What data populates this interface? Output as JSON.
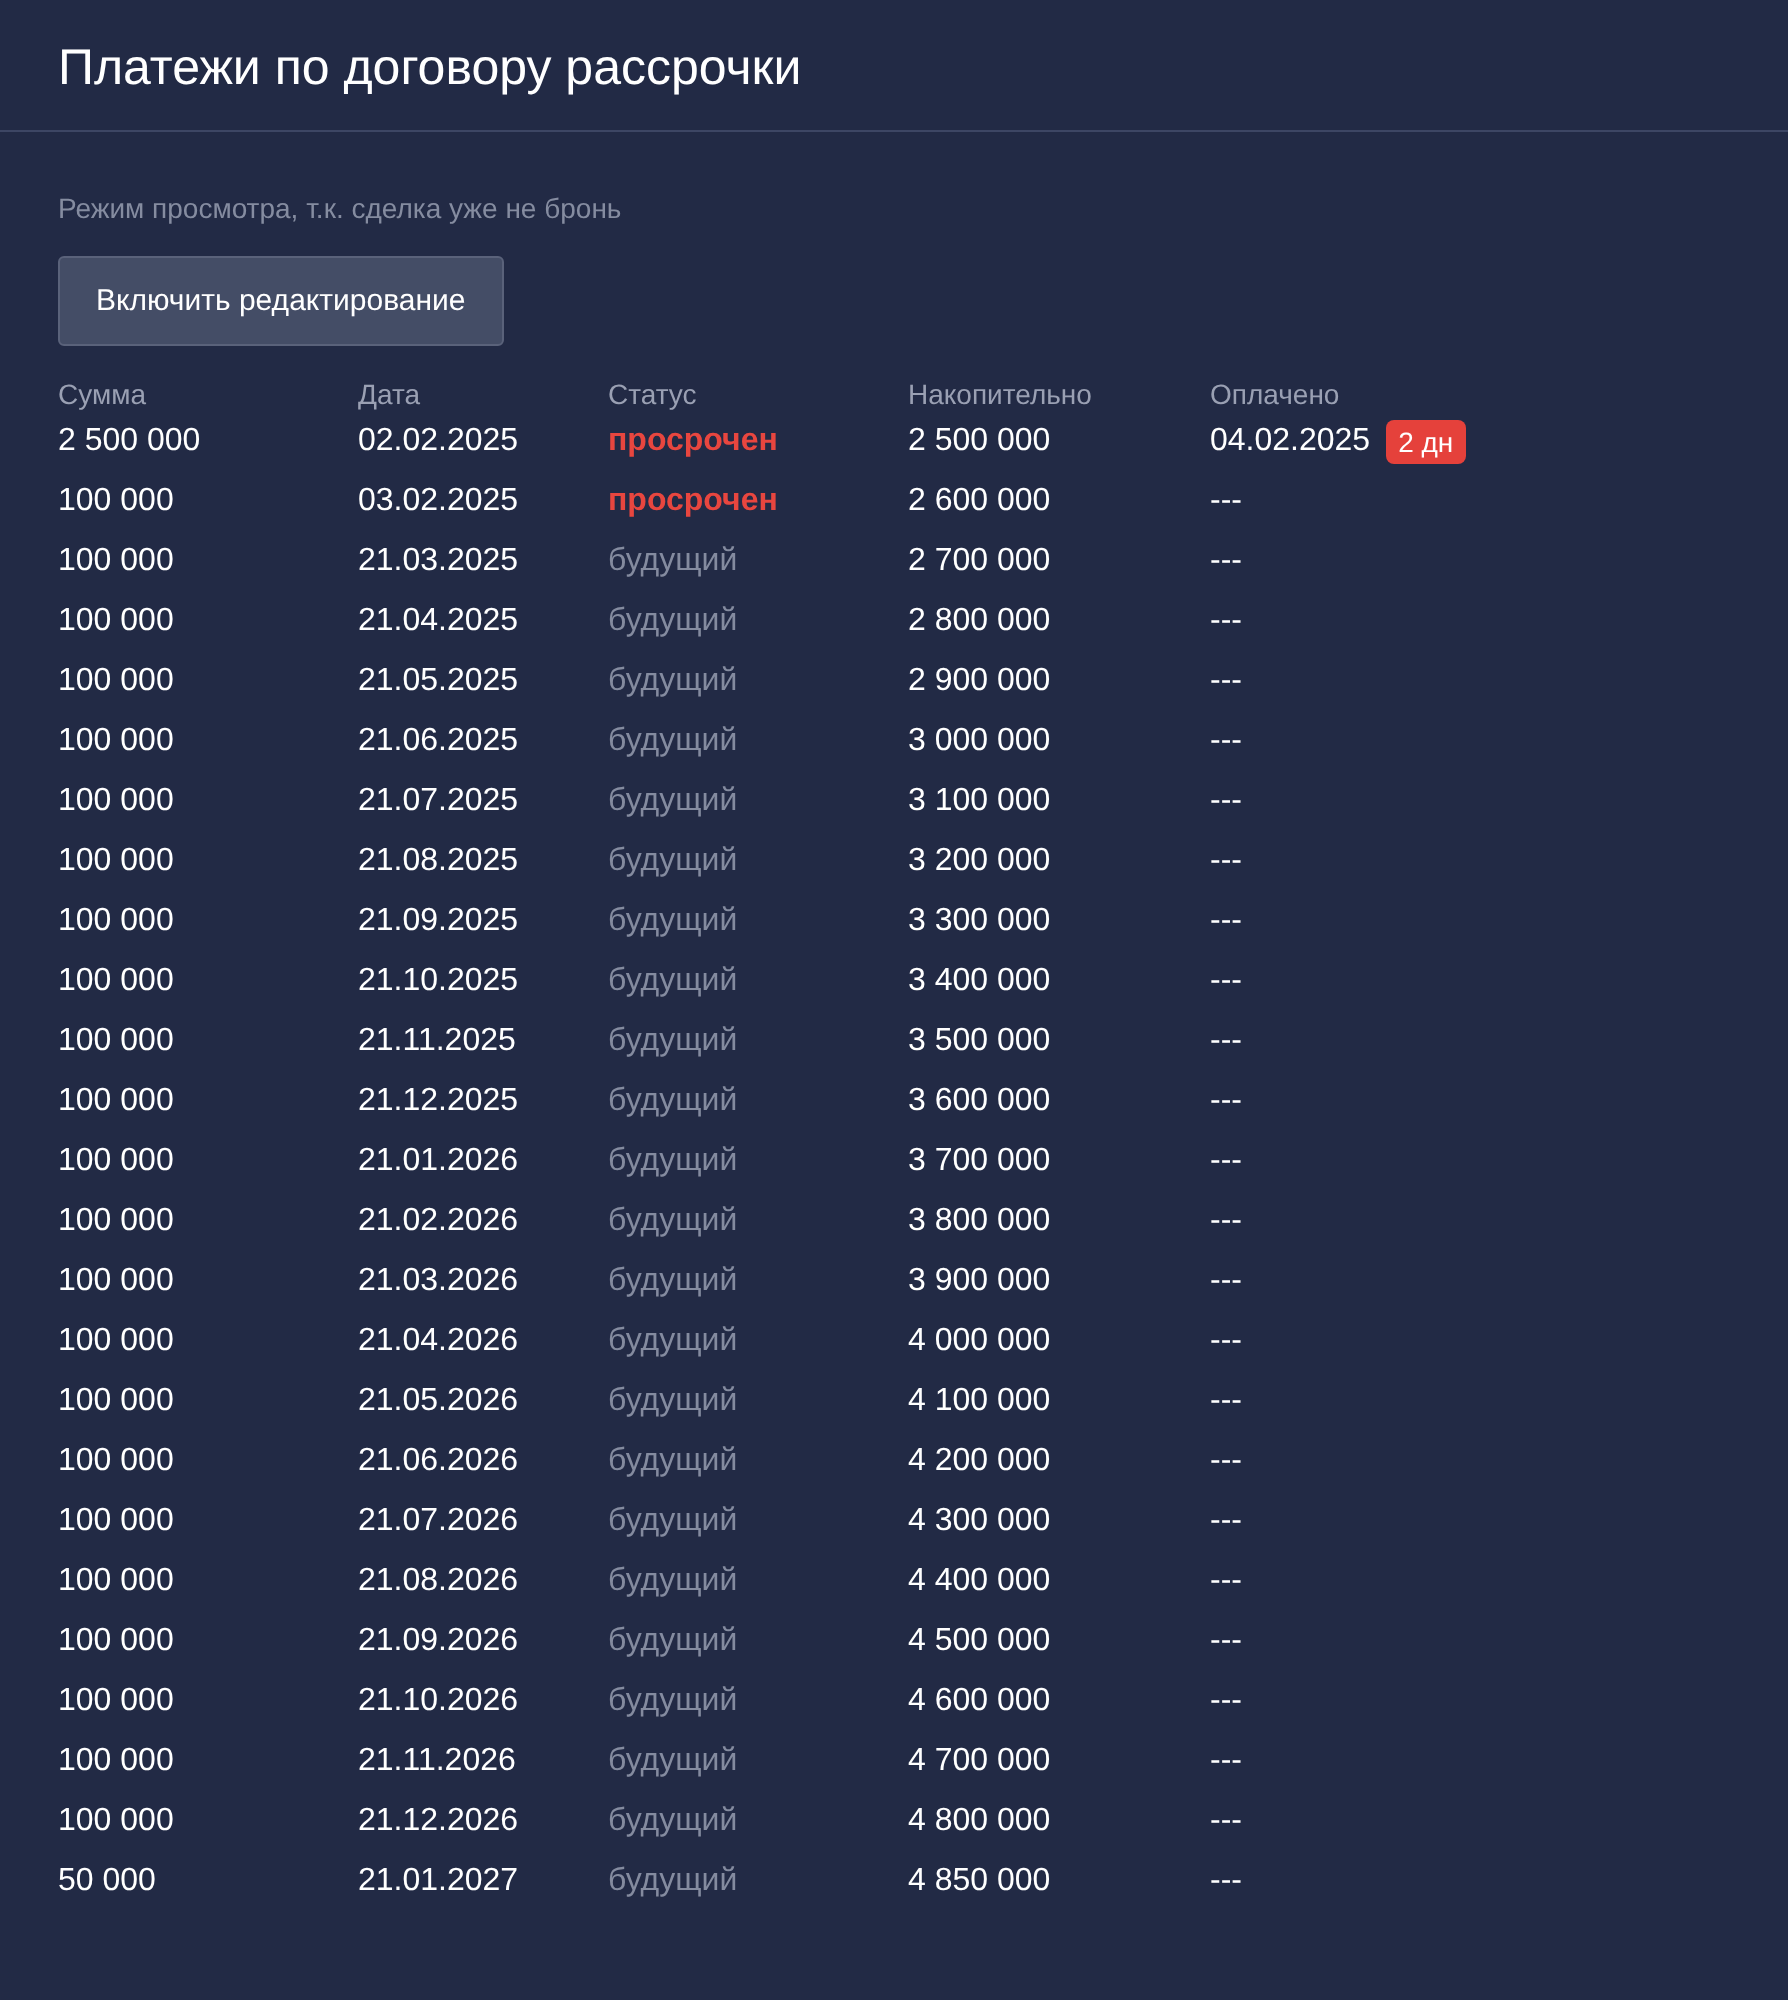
{
  "title": "Платежи по договору рассрочки",
  "notice": "Режим просмотра, т.к. сделка уже не бронь",
  "edit_button": "Включить редактирование",
  "table": {
    "columns": [
      "Сумма",
      "Дата",
      "Статус",
      "Накопительно",
      "Оплачено"
    ],
    "rows": [
      {
        "amount": "2 500 000",
        "date": "02.02.2025",
        "status": "просрочен",
        "overdue": true,
        "cumulative": "2 500 000",
        "paid": "04.02.2025",
        "delay": "2 дн"
      },
      {
        "amount": "100 000",
        "date": "03.02.2025",
        "status": "просрочен",
        "overdue": true,
        "cumulative": "2 600 000",
        "paid": "---"
      },
      {
        "amount": "100 000",
        "date": "21.03.2025",
        "status": "будущий",
        "overdue": false,
        "cumulative": "2 700 000",
        "paid": "---"
      },
      {
        "amount": "100 000",
        "date": "21.04.2025",
        "status": "будущий",
        "overdue": false,
        "cumulative": "2 800 000",
        "paid": "---"
      },
      {
        "amount": "100 000",
        "date": "21.05.2025",
        "status": "будущий",
        "overdue": false,
        "cumulative": "2 900 000",
        "paid": "---"
      },
      {
        "amount": "100 000",
        "date": "21.06.2025",
        "status": "будущий",
        "overdue": false,
        "cumulative": "3 000 000",
        "paid": "---"
      },
      {
        "amount": "100 000",
        "date": "21.07.2025",
        "status": "будущий",
        "overdue": false,
        "cumulative": "3 100 000",
        "paid": "---"
      },
      {
        "amount": "100 000",
        "date": "21.08.2025",
        "status": "будущий",
        "overdue": false,
        "cumulative": "3 200 000",
        "paid": "---"
      },
      {
        "amount": "100 000",
        "date": "21.09.2025",
        "status": "будущий",
        "overdue": false,
        "cumulative": "3 300 000",
        "paid": "---"
      },
      {
        "amount": "100 000",
        "date": "21.10.2025",
        "status": "будущий",
        "overdue": false,
        "cumulative": "3 400 000",
        "paid": "---"
      },
      {
        "amount": "100 000",
        "date": "21.11.2025",
        "status": "будущий",
        "overdue": false,
        "cumulative": "3 500 000",
        "paid": "---"
      },
      {
        "amount": "100 000",
        "date": "21.12.2025",
        "status": "будущий",
        "overdue": false,
        "cumulative": "3 600 000",
        "paid": "---"
      },
      {
        "amount": "100 000",
        "date": "21.01.2026",
        "status": "будущий",
        "overdue": false,
        "cumulative": "3 700 000",
        "paid": "---"
      },
      {
        "amount": "100 000",
        "date": "21.02.2026",
        "status": "будущий",
        "overdue": false,
        "cumulative": "3 800 000",
        "paid": "---"
      },
      {
        "amount": "100 000",
        "date": "21.03.2026",
        "status": "будущий",
        "overdue": false,
        "cumulative": "3 900 000",
        "paid": "---"
      },
      {
        "amount": "100 000",
        "date": "21.04.2026",
        "status": "будущий",
        "overdue": false,
        "cumulative": "4 000 000",
        "paid": "---"
      },
      {
        "amount": "100 000",
        "date": "21.05.2026",
        "status": "будущий",
        "overdue": false,
        "cumulative": "4 100 000",
        "paid": "---"
      },
      {
        "amount": "100 000",
        "date": "21.06.2026",
        "status": "будущий",
        "overdue": false,
        "cumulative": "4 200 000",
        "paid": "---"
      },
      {
        "amount": "100 000",
        "date": "21.07.2026",
        "status": "будущий",
        "overdue": false,
        "cumulative": "4 300 000",
        "paid": "---"
      },
      {
        "amount": "100 000",
        "date": "21.08.2026",
        "status": "будущий",
        "overdue": false,
        "cumulative": "4 400 000",
        "paid": "---"
      },
      {
        "amount": "100 000",
        "date": "21.09.2026",
        "status": "будущий",
        "overdue": false,
        "cumulative": "4 500 000",
        "paid": "---"
      },
      {
        "amount": "100 000",
        "date": "21.10.2026",
        "status": "будущий",
        "overdue": false,
        "cumulative": "4 600 000",
        "paid": "---"
      },
      {
        "amount": "100 000",
        "date": "21.11.2026",
        "status": "будущий",
        "overdue": false,
        "cumulative": "4 700 000",
        "paid": "---"
      },
      {
        "amount": "100 000",
        "date": "21.12.2026",
        "status": "будущий",
        "overdue": false,
        "cumulative": "4 800 000",
        "paid": "---"
      },
      {
        "amount": "50 000",
        "date": "21.01.2027",
        "status": "будущий",
        "overdue": false,
        "cumulative": "4 850 000",
        "paid": "---"
      }
    ]
  }
}
